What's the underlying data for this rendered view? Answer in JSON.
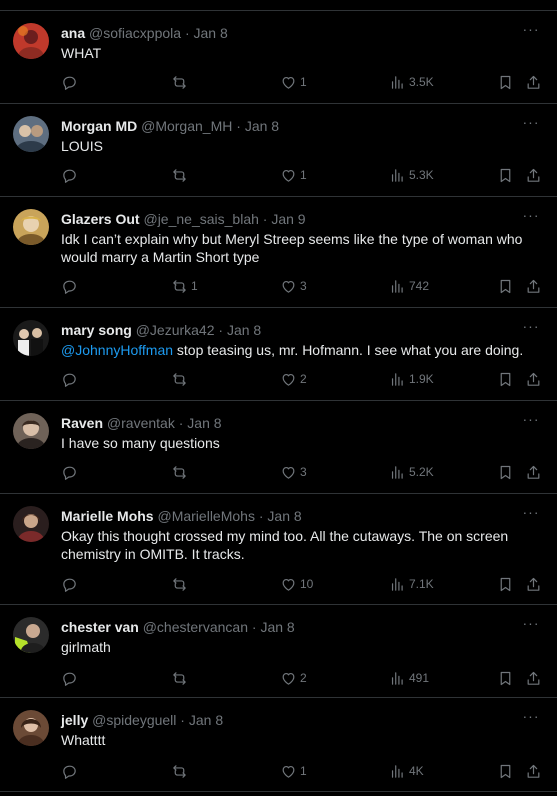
{
  "colors": {
    "background": "#000000",
    "text": "#e7e9ea",
    "secondary": "#71767b",
    "link": "#1d9bf0",
    "divider": "#2f3336"
  },
  "icons": [
    "reply-icon",
    "repost-icon",
    "like-icon",
    "views-icon",
    "bookmark-icon",
    "share-icon",
    "more-icon"
  ],
  "tweets": [
    {
      "name": "ana",
      "handle": "@sofiacxppola",
      "dot": "·",
      "date": "Jan 8",
      "line1": "WHAT",
      "line2": "",
      "mention": "",
      "replies": "",
      "reposts": "",
      "likes": "1",
      "views": "3.5K",
      "avatar_color": "#c0392b"
    },
    {
      "name": "Morgan MD",
      "handle": "@Morgan_MH",
      "dot": "·",
      "date": "Jan 8",
      "line1": "LOUIS",
      "line2": "",
      "mention": "",
      "replies": "",
      "reposts": "",
      "likes": "1",
      "views": "5.3K",
      "avatar_color": "#7a8a9a"
    },
    {
      "name": "Glazers Out",
      "handle": "@je_ne_sais_blah",
      "dot": "·",
      "date": "Jan 9",
      "line1": "Idk I can’t explain why but Meryl Streep seems like the type of woman who",
      "line2": "would marry a Martin Short type",
      "mention": "",
      "replies": "",
      "reposts": "1",
      "likes": "3",
      "views": "742",
      "avatar_color": "#c9a45a"
    },
    {
      "name": "mary song",
      "handle": "@Jezurka42",
      "dot": "·",
      "date": "Jan 8",
      "line1": " stop teasing us, mr. Hofmann. I see what you are doing.",
      "line2": "",
      "mention": "@JohnnyHoffman",
      "replies": "",
      "reposts": "",
      "likes": "2",
      "views": "1.9K",
      "avatar_color": "#3a3a3a"
    },
    {
      "name": "Raven",
      "handle": "@raventak",
      "dot": "·",
      "date": "Jan 8",
      "line1": "I have so many questions",
      "line2": "",
      "mention": "",
      "replies": "",
      "reposts": "",
      "likes": "3",
      "views": "5.2K",
      "avatar_color": "#8a7a6a"
    },
    {
      "name": "Marielle Mohs",
      "handle": "@MarielleMohs",
      "dot": "·",
      "date": "Jan 8",
      "line1": "Okay this thought crossed my mind too. All the cutaways. The on screen",
      "line2": "chemistry in OMITB. It tracks.",
      "mention": "",
      "replies": "",
      "reposts": "",
      "likes": "10",
      "views": "7.1K",
      "avatar_color": "#5a3a3a"
    },
    {
      "name": "chester van",
      "handle": "@chestervancan",
      "dot": "·",
      "date": "Jan 8",
      "line1": "girlmath",
      "line2": "",
      "mention": "",
      "replies": "",
      "reposts": "",
      "likes": "2",
      "views": "491",
      "avatar_color": "#9acd32"
    },
    {
      "name": "jelly",
      "handle": "@spideyguell",
      "dot": "·",
      "date": "Jan 8",
      "line1": "Whatttt",
      "line2": "",
      "mention": "",
      "replies": "",
      "reposts": "",
      "likes": "1",
      "views": "4K",
      "avatar_color": "#8b5a3c"
    }
  ]
}
